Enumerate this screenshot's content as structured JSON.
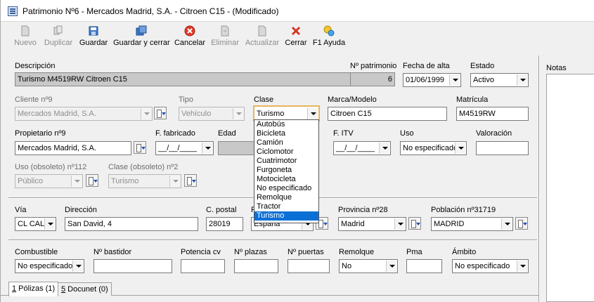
{
  "window": {
    "title": "Patrimonio Nº6 - Mercados Madrid, S.A. - Citroen C15 -  (Modificado)"
  },
  "toolbar": {
    "nuevo": "Nuevo",
    "duplicar": "Duplicar",
    "guardar": "Guardar",
    "guardar_cerrar": "Guardar y cerrar",
    "cancelar": "Cancelar",
    "eliminar": "Eliminar",
    "actualizar": "Actualizar",
    "cerrar": "Cerrar",
    "ayuda": "F1 Ayuda"
  },
  "labels": {
    "descripcion": "Descripción",
    "n_patrimonio": "Nº patrimonio",
    "fecha_alta": "Fecha de alta",
    "estado": "Estado",
    "cliente": "Cliente nº9",
    "tipo": "Tipo",
    "clase": "Clase",
    "marca": "Marca/Modelo",
    "matricula": "Matrícula",
    "propietario": "Propietario nº9",
    "f_fabricado": "F. fabricado",
    "edad": "Edad",
    "f_itv": "F. ITV",
    "uso": "Uso",
    "valoracion": "Valoración",
    "uso_obsoleto": "Uso (obsoleto) nº112",
    "clase_obsoleto": "Clase (obsoleto) nº2",
    "via": "Vía",
    "direccion": "Dirección",
    "c_postal": "C. postal",
    "pais": "P",
    "provincia": "Provincia nº28",
    "poblacion": "Población nº31719",
    "combustible": "Combustible",
    "n_bastidor": "Nº bastidor",
    "potencia": "Potencia cv",
    "n_plazas": "Nº plazas",
    "n_puertas": "Nº puertas",
    "remolque": "Remolque",
    "pma": "Pma",
    "ambito": "Ámbito",
    "notas": "Notas"
  },
  "values": {
    "descripcion": "Turismo M4519RW Citroen C15",
    "n_patrimonio": "6",
    "fecha_alta": "01/06/1999",
    "estado": "Activo",
    "cliente": "Mercados Madrid, S.A.",
    "tipo": "Vehículo",
    "clase": "Turismo",
    "marca": "Citroen C15",
    "matricula": "M4519RW",
    "propietario": "Mercados Madrid, S.A.",
    "f_fabricado": "__/__/____",
    "edad": "",
    "f_itv": "__/__/____",
    "uso": "No especificado",
    "valoracion": "",
    "uso_obsoleto": "Público",
    "clase_obsoleto": "Turismo",
    "via": "CL CAL",
    "direccion": "San David, 4",
    "c_postal": "28019",
    "pais": "España",
    "provincia": "Madrid",
    "poblacion": "MADRID",
    "combustible": "No especificado",
    "n_bastidor": "",
    "potencia": "",
    "n_plazas": "",
    "n_puertas": "",
    "remolque": "No",
    "pma": "",
    "ambito": "No especificado"
  },
  "clase_options": [
    "Autobús",
    "Bicicleta",
    "Camión",
    "Ciclomotor",
    "Cuatrimotor",
    "Furgoneta",
    "Motocicleta",
    "No especificado",
    "Remolque",
    "Tractor",
    "Turismo"
  ],
  "clase_selected_index": 10,
  "tabs": [
    {
      "num": "1",
      "label": " Pólizas (1)"
    },
    {
      "num": "5",
      "label": " Docunet (0)"
    }
  ],
  "colors": {
    "selection": "#0b70d6",
    "readonly_bg": "#c8c8c8",
    "focus_border": "#e6b55e"
  }
}
